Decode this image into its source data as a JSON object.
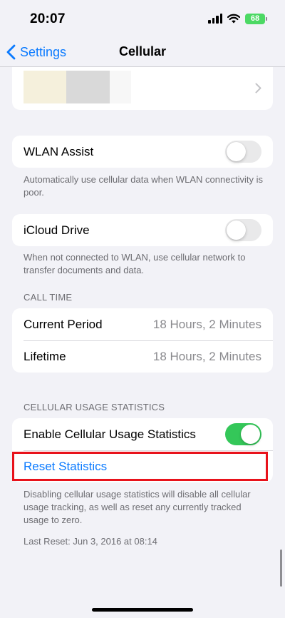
{
  "status_bar": {
    "time": "20:07",
    "battery": "68",
    "icons": [
      "signal-icon",
      "wifi-icon",
      "battery-icon"
    ]
  },
  "nav": {
    "back_label": "Settings",
    "title": "Cellular"
  },
  "wlan_assist": {
    "label": "WLAN Assist",
    "enabled": false,
    "footer": "Automatically use cellular data when WLAN connectivity is poor."
  },
  "icloud_drive": {
    "label": "iCloud Drive",
    "enabled": false,
    "footer": "When not connected to WLAN, use cellular network to transfer documents and data."
  },
  "call_time": {
    "header": "CALL TIME",
    "rows": [
      {
        "label": "Current Period",
        "value": "18 Hours, 2 Minutes"
      },
      {
        "label": "Lifetime",
        "value": "18 Hours, 2 Minutes"
      }
    ]
  },
  "usage_stats": {
    "header": "CELLULAR USAGE STATISTICS",
    "enable_label": "Enable Cellular Usage Statistics",
    "enabled": true,
    "reset_label": "Reset Statistics",
    "footer": "Disabling cellular usage statistics will disable all cellular usage tracking, as well as reset any currently tracked usage to zero.",
    "last_reset": "Last Reset: Jun 3, 2016 at 08:14"
  },
  "colors": {
    "accent": "#0a7aff",
    "toggle_on": "#34c759",
    "highlight": "#e8121b",
    "background": "#f2f2f7"
  }
}
